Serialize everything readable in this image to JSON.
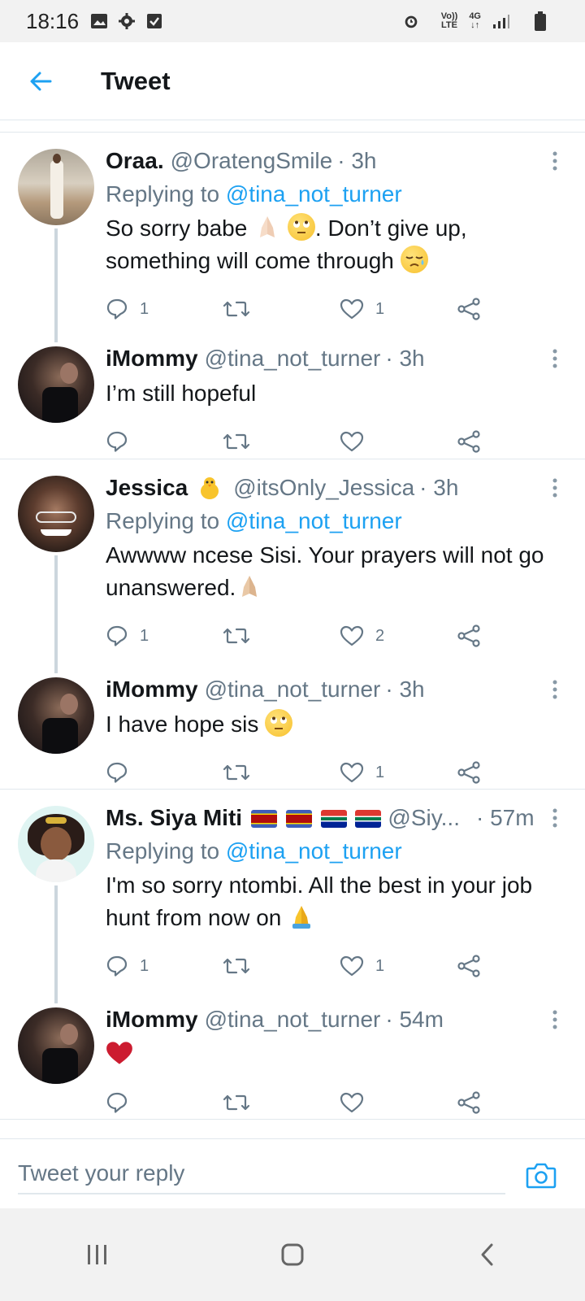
{
  "status_bar": {
    "time": "18:16",
    "network_label_top": "Vo))",
    "network_label_bottom": "LTE",
    "signal_label_top": "4G",
    "signal_label_bottom": "↓↑"
  },
  "header": {
    "title": "Tweet"
  },
  "replying_label": "Replying to",
  "tweets": [
    {
      "name": "Oraa.",
      "handle": "@OratengSmile",
      "time": "· 3h",
      "replying_to": "@tina_not_turner",
      "text_parts": [
        "So sorry babe",
        ". Don’t give up, something will come through"
      ],
      "reply_count": "1",
      "retweet_count": "",
      "like_count": "1"
    },
    {
      "name": "iMommy",
      "handle": "@tina_not_turner",
      "time": "· 3h",
      "text": "I’m still hopeful",
      "reply_count": "",
      "retweet_count": "",
      "like_count": ""
    },
    {
      "name": "Jessica",
      "handle": "@itsOnly_Jessica",
      "time": "· 3h",
      "replying_to": "@tina_not_turner",
      "text": "Awwww ncese Sisi. Your prayers will not go unanswered.",
      "reply_count": "1",
      "retweet_count": "",
      "like_count": "2"
    },
    {
      "name": "iMommy",
      "handle": "@tina_not_turner",
      "time": "· 3h",
      "text": "I have hope sis",
      "reply_count": "",
      "retweet_count": "",
      "like_count": "1"
    },
    {
      "name": "Ms. Siya Miti",
      "handle": "@Siy...",
      "time": "· 57m",
      "replying_to": "@tina_not_turner",
      "text": "I'm so sorry ntombi. All the best in your job hunt from now on",
      "reply_count": "1",
      "retweet_count": "",
      "like_count": "1"
    },
    {
      "name": "iMommy",
      "handle": "@tina_not_turner",
      "time": "· 54m",
      "text": "",
      "reply_count": "",
      "retweet_count": "",
      "like_count": ""
    }
  ],
  "reply_bar": {
    "placeholder": "Tweet your reply"
  },
  "colors": {
    "accent": "#1da1f2",
    "text_primary": "#14171a",
    "text_secondary": "#657786",
    "divider": "#e1e8ed",
    "heart": "#cc1c30"
  },
  "icons": [
    "back-arrow-icon",
    "more-icon",
    "reply-icon",
    "retweet-icon",
    "like-icon",
    "share-icon",
    "camera-icon",
    "recent-apps-icon",
    "home-icon",
    "back-nav-icon"
  ]
}
